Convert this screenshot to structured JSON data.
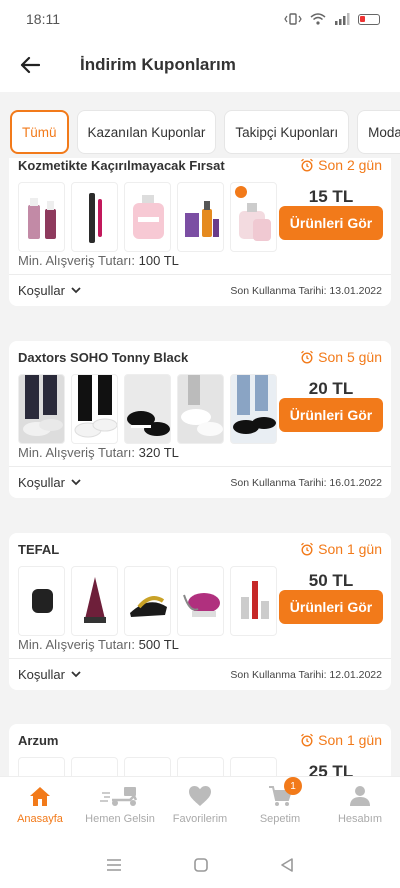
{
  "status": {
    "time": "18:11"
  },
  "header": {
    "title": "İndirim Kuponlarım"
  },
  "tabs": [
    "Tümü",
    "Kazanılan Kuponlar",
    "Takipçi Kuponları",
    "Moda"
  ],
  "coupons": [
    {
      "brand": "Kozmetikte Kaçırılmayacak Fırsat",
      "days": "Son 2 gün",
      "amount": "15 TL",
      "button": "Ürünleri Gör",
      "min_label": "Min. Alışveriş Tutarı:",
      "min_value": "100 TL",
      "conditions": "Koşullar",
      "expiry": "Son Kullanma Tarihi: 13.01.2022"
    },
    {
      "brand": "Daxtors SOHO Tonny Black",
      "days": "Son 5 gün",
      "amount": "20 TL",
      "button": "Ürünleri Gör",
      "min_label": "Min. Alışveriş Tutarı:",
      "min_value": "320 TL",
      "conditions": "Koşullar",
      "expiry": "Son Kullanma Tarihi: 16.01.2022"
    },
    {
      "brand": "TEFAL",
      "days": "Son 1 gün",
      "amount": "50 TL",
      "button": "Ürünleri Gör",
      "min_label": "Min. Alışveriş Tutarı:",
      "min_value": "500 TL",
      "conditions": "Koşullar",
      "expiry": "Son Kullanma Tarihi: 12.01.2022"
    },
    {
      "brand": "Arzum",
      "days": "Son 1 gün",
      "amount": "25 TL"
    }
  ],
  "nav": [
    {
      "label": "Anasayfa",
      "icon": "home-icon"
    },
    {
      "label": "Hemen Gelsin",
      "icon": "scooter-icon"
    },
    {
      "label": "Favorilerim",
      "icon": "heart-icon"
    },
    {
      "label": "Sepetim",
      "icon": "cart-icon",
      "badge": "1"
    },
    {
      "label": "Hesabım",
      "icon": "user-icon"
    }
  ],
  "colors": {
    "accent": "#f27a1a"
  }
}
